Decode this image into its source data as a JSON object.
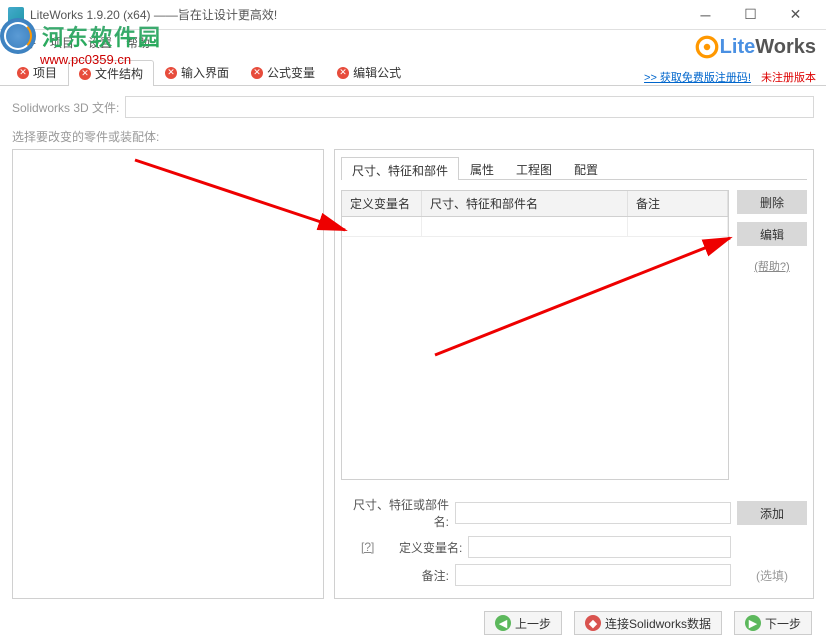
{
  "titlebar": {
    "text": "LiteWorks 1.9.20 (x64)  ——旨在让设计更高效!"
  },
  "watermark": {
    "name": "河东软件园",
    "url": "www.pc0359.cn"
  },
  "menu": {
    "file": "文件",
    "project": "项目",
    "settings": "设置",
    "help": "帮助"
  },
  "logo": {
    "lite": "Lite",
    "works": "Works"
  },
  "tabs": {
    "project": "项目",
    "structure": "文件结构",
    "input": "输入界面",
    "formula": "公式变量",
    "edit": "编辑公式",
    "getcode": ">> 获取免费版注册码!",
    "unreg": "未注册版本"
  },
  "fileline": {
    "label": "Solidworks 3D 文件:"
  },
  "subtitle": "选择要改变的零件或装配体:",
  "subtabs": {
    "t1": "尺寸、特征和部件",
    "t2": "属性",
    "t3": "工程图",
    "t4": "配置"
  },
  "grid": {
    "c1": "定义变量名",
    "c2": "尺寸、特征和部件名",
    "c3": "备注"
  },
  "buttons": {
    "delete": "删除",
    "edit": "编辑",
    "help": "(帮助?)",
    "add": "添加"
  },
  "form": {
    "l1": "尺寸、特征或部件名:",
    "l2": "定义变量名:",
    "l3": "备注:",
    "q": "[?]",
    "opt": "(选填)"
  },
  "footer": {
    "prev": "上一步",
    "connect": "连接Solidworks数据",
    "next": "下一步"
  }
}
